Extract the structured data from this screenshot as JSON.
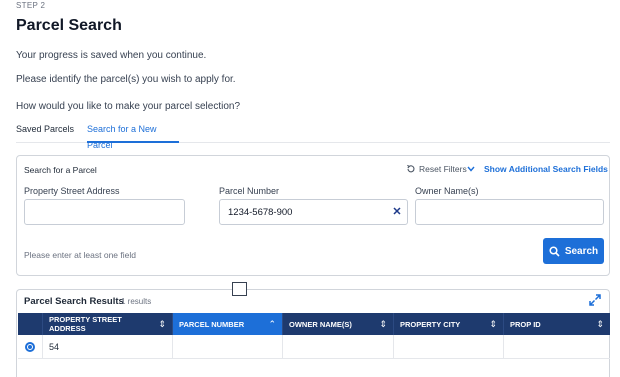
{
  "header": {
    "step": "STEP 2",
    "title": "Parcel Search",
    "progress_note": "Your progress is saved when you continue.",
    "instruction": "Please identify the parcel(s) you wish to apply for.",
    "question": "How would you like to make your parcel selection?"
  },
  "tabs": [
    {
      "label": "Saved Parcels",
      "active": false
    },
    {
      "label": "Search for a New Parcel",
      "active": true
    }
  ],
  "search_card": {
    "title": "Search for a Parcel",
    "reset_label": "Reset Filters",
    "show_more_label": "Show Additional Search Fields",
    "fields": {
      "address": {
        "label": "Property Street Address",
        "value": ""
      },
      "parcel": {
        "label": "Parcel Number",
        "value": "1234-5678-900"
      },
      "owner": {
        "label": "Owner Name(s)",
        "value": ""
      }
    },
    "clear_glyph": "✕",
    "hint": "Please enter at least one field",
    "search_label": "Search"
  },
  "results": {
    "title": "Parcel Search Results",
    "count": "1 results",
    "columns": [
      {
        "label": "PROPERTY STREET ADDRESS",
        "sort": "⇕"
      },
      {
        "label": "PARCEL NUMBER",
        "sort": "⌃"
      },
      {
        "label": "OWNER NAME(S)",
        "sort": "⇕"
      },
      {
        "label": "PROPERTY CITY",
        "sort": "⇕"
      },
      {
        "label": "PROP ID",
        "sort": "⇕"
      }
    ],
    "rows": [
      {
        "selected": true,
        "address": "54",
        "parcel": "",
        "owner": "",
        "city": "",
        "prop_id": ""
      }
    ]
  },
  "colors": {
    "accent": "#1d6fd8",
    "table_header": "#1e3a6e"
  }
}
